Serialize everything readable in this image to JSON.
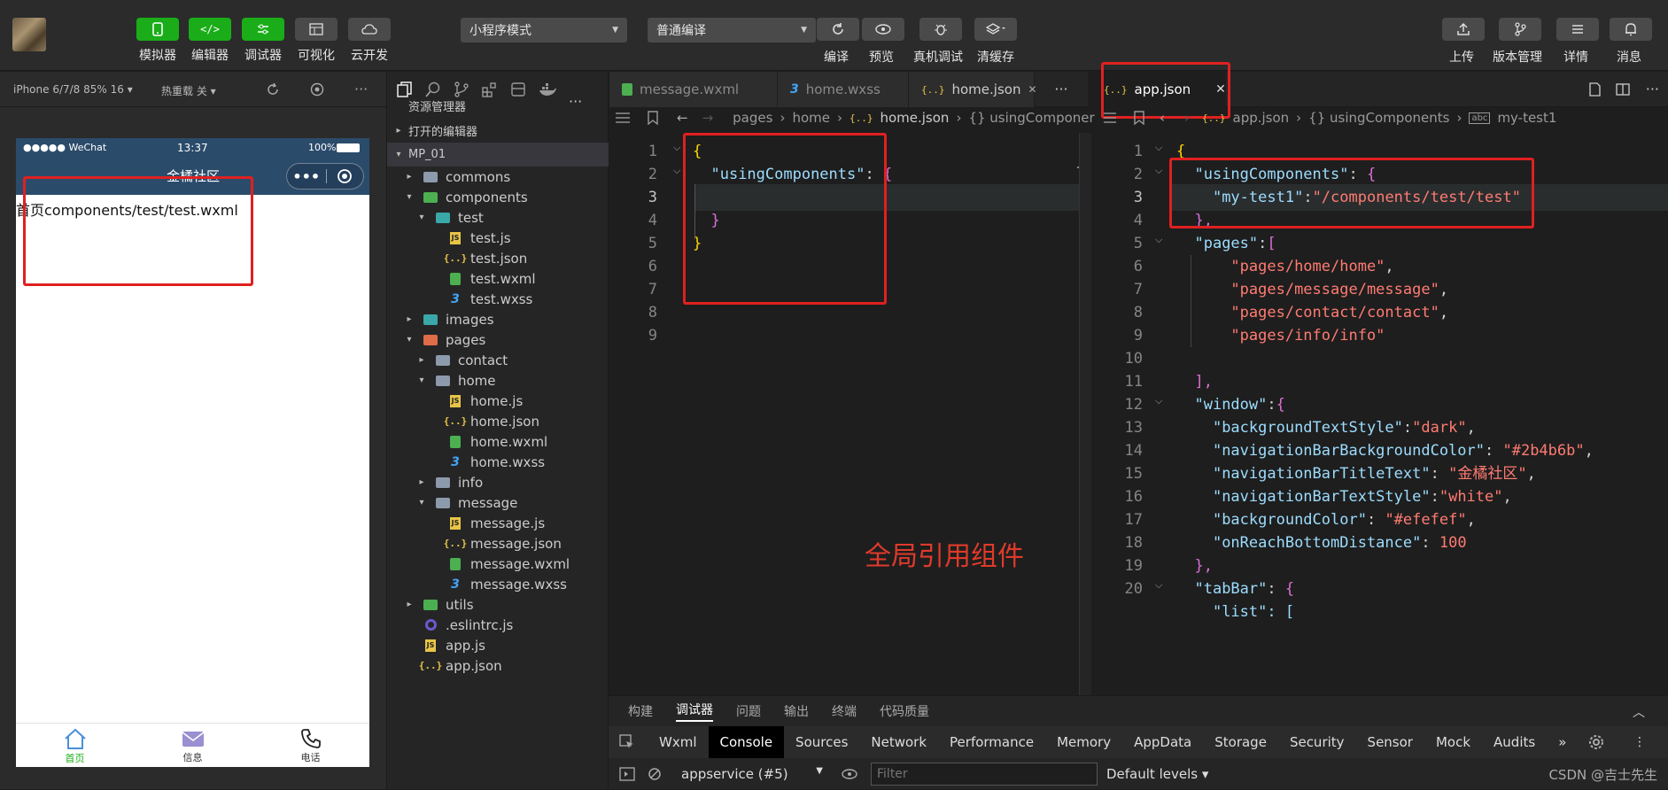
{
  "toolbar": {
    "left_buttons": [
      {
        "label": "模拟器",
        "icon": "phone-icon"
      },
      {
        "label": "编辑器",
        "icon": "code-icon"
      },
      {
        "label": "调试器",
        "icon": "debug-icon"
      },
      {
        "label": "可视化",
        "icon": "layout-icon"
      },
      {
        "label": "云开发",
        "icon": "cloud-icon"
      }
    ],
    "mode_select": "小程序模式",
    "compile_select": "普通编译",
    "mid_buttons": [
      {
        "label": "编译",
        "icon": "refresh-icon"
      },
      {
        "label": "预览",
        "icon": "eye-icon"
      },
      {
        "label": "真机调试",
        "icon": "bug-icon"
      },
      {
        "label": "清缓存",
        "icon": "layers-icon"
      }
    ],
    "right_buttons": [
      {
        "label": "上传",
        "icon": "upload-icon"
      },
      {
        "label": "版本管理",
        "icon": "branch-icon"
      },
      {
        "label": "详情",
        "icon": "menu-icon"
      },
      {
        "label": "消息",
        "icon": "bell-icon"
      }
    ]
  },
  "simulator": {
    "device": "iPhone 6/7/8 85% 16 ▾",
    "hot_reload": "热重载 关 ▾",
    "more": "···",
    "status_carrier": "●●●●● WeChat",
    "status_time": "13:37",
    "status_battery": "100%",
    "nav_title": "金橘社区",
    "page_text": "首页components/test/test.wxml",
    "tabs": [
      {
        "label": "首页",
        "icon": "home-icon",
        "color": "#1aad19"
      },
      {
        "label": "信息",
        "icon": "mail-icon",
        "color": "#333333"
      },
      {
        "label": "电话",
        "icon": "phone-call-icon",
        "color": "#333333"
      }
    ]
  },
  "explorer": {
    "title": "资源管理器",
    "more": "···",
    "open_editors": "打开的编辑器",
    "project": "MP_01",
    "tree": [
      {
        "label": "commons",
        "type": "folder",
        "depth": 1,
        "arrow": "▸"
      },
      {
        "label": "components",
        "type": "folder-green",
        "depth": 1,
        "arrow": "▾"
      },
      {
        "label": "test",
        "type": "folder-teal",
        "depth": 2,
        "arrow": "▾"
      },
      {
        "label": "test.js",
        "type": "js",
        "depth": 3,
        "arrow": ""
      },
      {
        "label": "test.json",
        "type": "json",
        "depth": 3,
        "arrow": ""
      },
      {
        "label": "test.wxml",
        "type": "wxml",
        "depth": 3,
        "arrow": ""
      },
      {
        "label": "test.wxss",
        "type": "wxss",
        "depth": 3,
        "arrow": ""
      },
      {
        "label": "images",
        "type": "folder-teal",
        "depth": 1,
        "arrow": "▸"
      },
      {
        "label": "pages",
        "type": "folder-orange",
        "depth": 1,
        "arrow": "▾"
      },
      {
        "label": "contact",
        "type": "folder",
        "depth": 2,
        "arrow": "▸"
      },
      {
        "label": "home",
        "type": "folder",
        "depth": 2,
        "arrow": "▾"
      },
      {
        "label": "home.js",
        "type": "js",
        "depth": 3,
        "arrow": ""
      },
      {
        "label": "home.json",
        "type": "json",
        "depth": 3,
        "arrow": ""
      },
      {
        "label": "home.wxml",
        "type": "wxml",
        "depth": 3,
        "arrow": ""
      },
      {
        "label": "home.wxss",
        "type": "wxss",
        "depth": 3,
        "arrow": ""
      },
      {
        "label": "info",
        "type": "folder",
        "depth": 2,
        "arrow": "▸"
      },
      {
        "label": "message",
        "type": "folder",
        "depth": 2,
        "arrow": "▾"
      },
      {
        "label": "message.js",
        "type": "js",
        "depth": 3,
        "arrow": ""
      },
      {
        "label": "message.json",
        "type": "json",
        "depth": 3,
        "arrow": ""
      },
      {
        "label": "message.wxml",
        "type": "wxml",
        "depth": 3,
        "arrow": ""
      },
      {
        "label": "message.wxss",
        "type": "wxss",
        "depth": 3,
        "arrow": ""
      },
      {
        "label": "utils",
        "type": "folder-green",
        "depth": 1,
        "arrow": "▸"
      },
      {
        "label": ".eslintrc.js",
        "type": "eslint",
        "depth": 1,
        "arrow": ""
      },
      {
        "label": "app.js",
        "type": "js",
        "depth": 1,
        "arrow": ""
      },
      {
        "label": "app.json",
        "type": "json",
        "depth": 1,
        "arrow": ""
      }
    ]
  },
  "editor_left": {
    "tabs": [
      {
        "label": "message.wxml",
        "icon": "wxml"
      },
      {
        "label": "home.wxss",
        "icon": "wxss"
      },
      {
        "label": "home.json",
        "icon": "json",
        "close": "✕",
        "active": true
      }
    ],
    "tabs_more": "···",
    "breadcrumb": [
      "pages",
      "home",
      "home.json",
      "{} usingComponer"
    ],
    "lines": [
      "1",
      "2",
      "3",
      "4",
      "5",
      "6",
      "7",
      "8",
      "9"
    ],
    "code": {
      "l1": "{",
      "l2_key": "\"usingComponents\"",
      "l2_colon": ": ",
      "l2_brace": "{",
      "l4": "}",
      "l5": "}"
    },
    "annotation": "全局引用组件"
  },
  "editor_right": {
    "tab_label": "app.json",
    "tab_close": "✕",
    "breadcrumb": [
      "app.json",
      "{} usingComponents",
      "my-test1"
    ],
    "lines": [
      "1",
      "2",
      "3",
      "4",
      "5",
      "6",
      "7",
      "8",
      "9",
      "10",
      "11",
      "12",
      "13",
      "14",
      "15",
      "16",
      "17",
      "18",
      "19",
      "20"
    ],
    "code": {
      "l1": "{",
      "l2_key": "\"usingComponents\"",
      "l2_rest": ": ",
      "l2_brace": "{",
      "l3_key": "\"my-test1\"",
      "l3_colon": ":",
      "l3_val": "\"/components/test/test\"",
      "l4": "},",
      "l5_key": "\"pages\"",
      "l5_colon": ":",
      "l5_br": "[",
      "l6": "\"pages/home/home\"",
      "l7": "\"pages/message/message\"",
      "l8": "\"pages/contact/contact\"",
      "l9": "\"pages/info/info\"",
      "l11": "],",
      "l12_key": "\"window\"",
      "l12_colon": ":",
      "l12_br": "{",
      "l13_key": "\"backgroundTextStyle\"",
      "l13_val": "\"dark\"",
      "l14_key": "\"navigationBarBackgroundColor\"",
      "l14_val": "\"#2b4b6b\"",
      "l15_key": "\"navigationBarTitleText\"",
      "l15_val": "\"金橘社区\"",
      "l16_key": "\"navigationBarTextStyle\"",
      "l16_val": "\"white\"",
      "l17_key": "\"backgroundColor\"",
      "l17_val": "\"#efefef\"",
      "l18_key": "\"onReachBottomDistance\"",
      "l18_val": "100",
      "l19": "},",
      "l20_key": "\"tabBar\"",
      "l20_br": "{",
      "l21": "\"list\": ["
    }
  },
  "devtools": {
    "top_tabs": [
      "构建",
      "调试器",
      "问题",
      "输出",
      "终端",
      "代码质量"
    ],
    "panel_tabs": [
      "Wxml",
      "Console",
      "Sources",
      "Network",
      "Performance",
      "Memory",
      "AppData",
      "Storage",
      "Security",
      "Sensor",
      "Mock",
      "Audits",
      "»"
    ],
    "context": "appservice (#5)",
    "filter_placeholder": "Filter",
    "levels": "Default levels ▾",
    "watermark": "CSDN @吉士先生"
  },
  "colors": {
    "accent_green": "#1aad19",
    "nav_bar": "#2b4b6b",
    "annotation_red": "#e02020"
  }
}
